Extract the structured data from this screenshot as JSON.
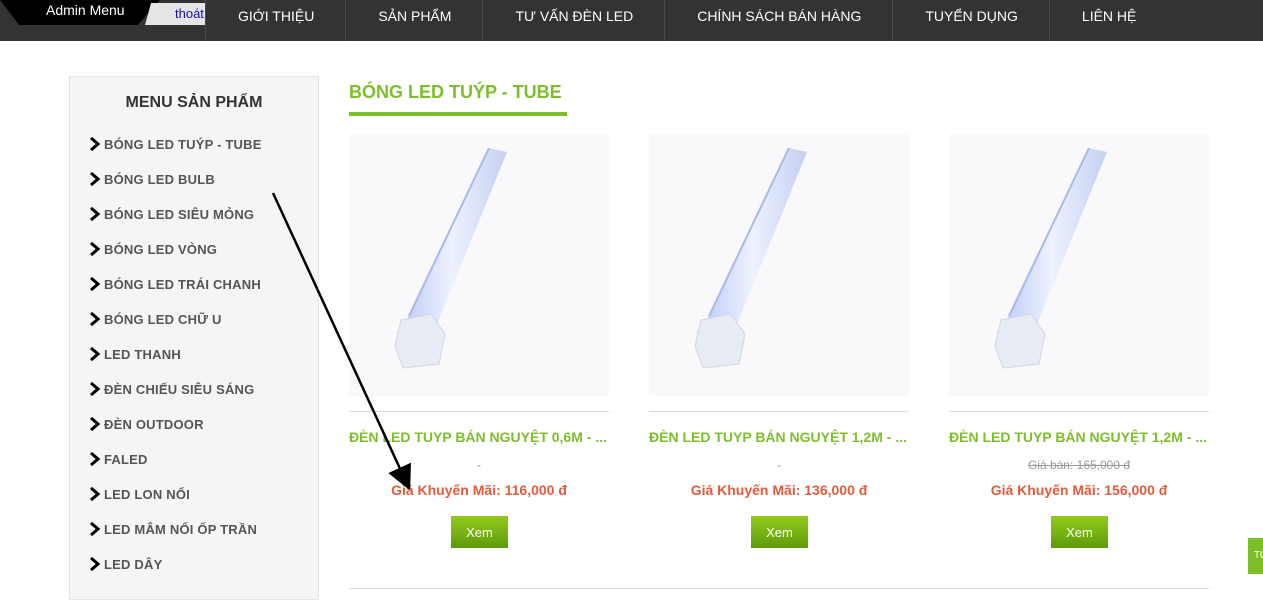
{
  "header": {
    "admin_label": "Admin Menu",
    "logout_label": "thoát",
    "nav": [
      "GIỚI THIỆU",
      "SẢN PHẨM",
      "TƯ VẤN ĐÈN LED",
      "CHÍNH SÁCH BÁN HÀNG",
      "TUYỂN DỤNG",
      "LIÊN HỆ"
    ]
  },
  "sidebar": {
    "title": "MENU SẢN PHẨM",
    "items": [
      {
        "label": "BÓNG LED TUÝP - TUBE"
      },
      {
        "label": "BÓNG LED BULB"
      },
      {
        "label": "BÓNG LED SIÊU MỎNG"
      },
      {
        "label": "BÓNG LED VÒNG"
      },
      {
        "label": "BÓNG LED TRÁI CHANH"
      },
      {
        "label": "BÓNG LED CHỮ U"
      },
      {
        "label": "LED THANH"
      },
      {
        "label": "ĐÈN CHIẾU SIÊU SÁNG"
      },
      {
        "label": "ĐÈN OUTDOOR"
      },
      {
        "label": "FALED"
      },
      {
        "label": "LED LON NỔI"
      },
      {
        "label": "LED MÂM NỔI ỐP TRẦN"
      },
      {
        "label": "LED DÂY"
      }
    ]
  },
  "section": {
    "title": "BÓNG LED TUÝP - TUBE"
  },
  "products": [
    {
      "name": "ĐÈN LED TUYP BÁN NGUYỆT 0,6M - ...",
      "old_price": "-",
      "price": "Giá Khuyến Mãi: 116,000 đ",
      "button": "Xem"
    },
    {
      "name": "ĐÈN LED TUYP BÁN NGUYỆT 1,2M - ...",
      "old_price": "-",
      "price": "Giá Khuyến Mãi: 136,000 đ",
      "button": "Xem"
    },
    {
      "name": "ĐÈN LED TUYP BÁN NGUYỆT 1,2M - ...",
      "old_price": "Giá bán: 165,000 đ",
      "price": "Giá Khuyến Mãi: 156,000 đ",
      "button": "Xem"
    }
  ],
  "to_top_label": "TO",
  "colors": {
    "accent_green": "#7dbf2a",
    "price_red": "#e55a3c",
    "topbar": "#333333"
  }
}
